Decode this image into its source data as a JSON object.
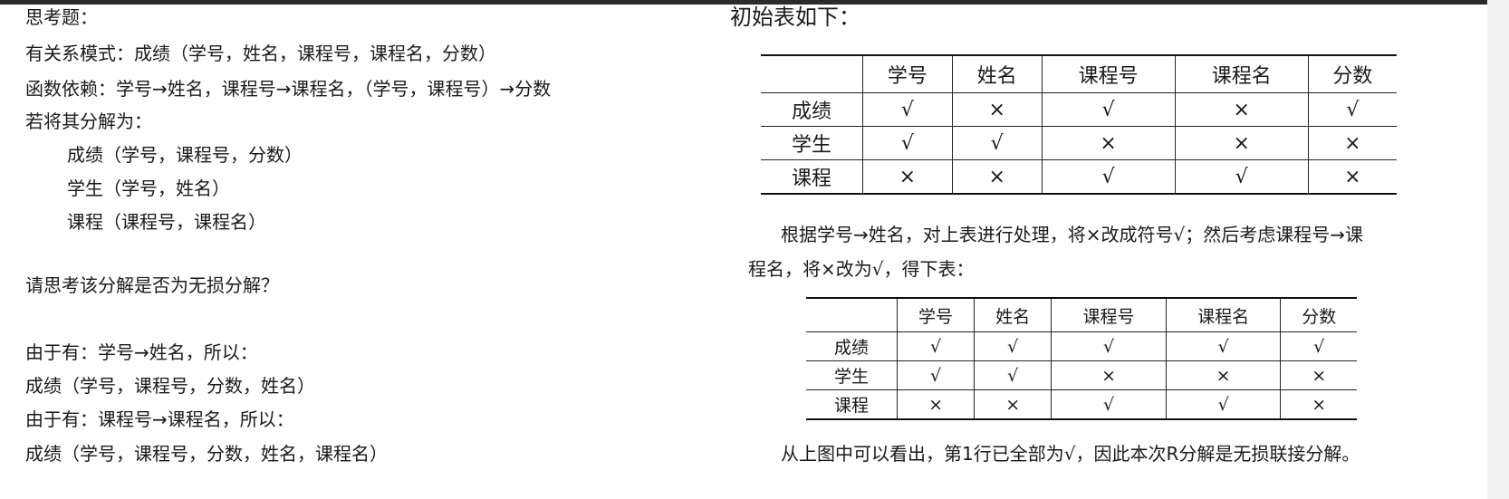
{
  "left": {
    "lines": [
      "思考题：",
      "有关系模式：成绩（学号，姓名，课程号，课程名，分数）",
      "函数依赖：学号→姓名，课程号→课程名，（学号，课程号）→分数",
      "若将其分解为：",
      "成绩（学号，课程号，分数）",
      "学生（学号，姓名）",
      "课程（课程号，课程名）",
      "请思考该分解是否为无损分解？",
      "由于有：学号→姓名，所以：",
      "成绩（学号，课程号，分数，姓名）",
      "由于有：课程号→课程名，所以：",
      "成绩（学号，课程号，分数，姓名，课程名）"
    ]
  },
  "right": {
    "title": "初始表如下：",
    "table1": {
      "headers": [
        "",
        "学号",
        "姓名",
        "课程号",
        "课程名",
        "分数"
      ],
      "rows": [
        [
          "成绩",
          "√",
          "×",
          "√",
          "×",
          "√"
        ],
        [
          "学生",
          "√",
          "√",
          "×",
          "×",
          "×"
        ],
        [
          "课程",
          "×",
          "×",
          "√",
          "√",
          "×"
        ]
      ]
    },
    "para1": "根据学号→姓名，对上表进行处理，将×改成符号√；然后考虑课程号→课",
    "para2": "程名，将×改为√，得下表：",
    "table2": {
      "headers": [
        "",
        "学号",
        "姓名",
        "课程号",
        "课程名",
        "分数"
      ],
      "rows": [
        [
          "成绩",
          "√",
          "√",
          "√",
          "√",
          "√"
        ],
        [
          "学生",
          "√",
          "√",
          "×",
          "×",
          "×"
        ],
        [
          "课程",
          "×",
          "×",
          "√",
          "√",
          "×"
        ]
      ]
    },
    "conclusion": "从上图中可以看出，第1行已全部为√，因此本次R分解是无损联接分解。"
  }
}
